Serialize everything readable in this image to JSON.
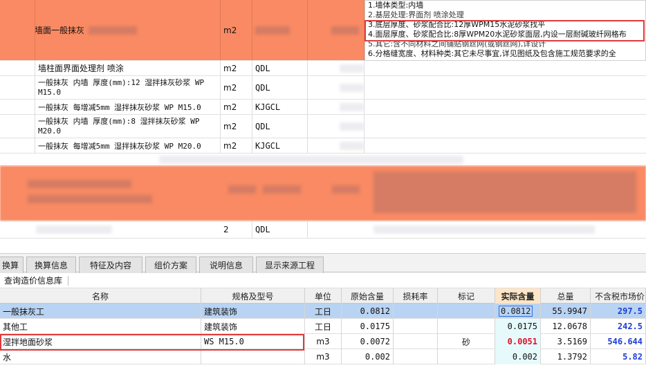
{
  "top_rows": [
    {
      "name": "墙面一般抹灰",
      "unit": "m2",
      "code": ""
    },
    {
      "name": "墙柱面界面处理剂 喷涂",
      "unit": "m2",
      "code": "QDL"
    },
    {
      "name": "一般抹灰 内墙 厚度(mm):12 湿拌抹灰砂浆 WP M15.0",
      "unit": "m2",
      "code": "QDL"
    },
    {
      "name": "一般抹灰 每增减5mm 湿拌抹灰砂浆 WP M15.0",
      "unit": "m2",
      "code": "KJGCL"
    },
    {
      "name": "一般抹灰 内墙 厚度(mm):8 湿拌抹灰砂浆 WP M20.0",
      "unit": "m2",
      "code": "QDL"
    },
    {
      "name": "一般抹灰 每增减5mm 湿拌抹灰砂浆 WP M20.0",
      "unit": "m2",
      "code": "KJGCL"
    },
    {
      "name": "",
      "unit": "2",
      "code": "QDL"
    }
  ],
  "description": {
    "line1": "1.墙体类型:内墙",
    "line2": "2.基层处理:界面剂 喷涂处理",
    "line3": "3.底层厚度、砂浆配合比:12厚WPM15水泥砂浆找平",
    "line4": "4.面层厚度、砂浆配合比:8厚WPM20水泥砂浆面层,内设一层耐碱玻纤网格布",
    "line5": "5.其它:含不同材料之间铺贴钢丝网(或钢丝网),详设计",
    "line6": "6.分格缝宽度、材料种类:其它未尽事宜,详见图纸及包含施工规范要求的全"
  },
  "tabs": [
    "换算",
    "换算信息",
    "特征及内容",
    "组价方案",
    "说明信息",
    "显示来源工程"
  ],
  "info_bar_label": "查询造价信息库",
  "table": {
    "headers": {
      "name": "名称",
      "spec": "规格及型号",
      "unit": "单位",
      "orig": "原始含量",
      "loss": "损耗率",
      "mark": "标记",
      "actual": "实际含量",
      "total": "总量",
      "price": "不含税市场价"
    },
    "rows": [
      {
        "name": "一般抹灰工",
        "spec": "建筑装饰",
        "unit": "工日",
        "orig": "0.0812",
        "loss": "",
        "mark": "",
        "actual": "0.0812",
        "total": "55.9947",
        "price": "297.5"
      },
      {
        "name": "其他工",
        "spec": "建筑装饰",
        "unit": "工日",
        "orig": "0.0175",
        "loss": "",
        "mark": "",
        "actual": "0.0175",
        "total": "12.0678",
        "price": "242.5"
      },
      {
        "name": "湿拌地面砂浆",
        "spec": "WS M15.0",
        "unit": "m3",
        "orig": "0.0072",
        "loss": "",
        "mark": "砂",
        "actual": "0.0051",
        "total": "3.5169",
        "price": "546.644"
      },
      {
        "name": "水",
        "spec": "",
        "unit": "m3",
        "orig": "0.002",
        "loss": "",
        "mark": "",
        "actual": "0.002",
        "total": "1.3792",
        "price": "5.82"
      }
    ]
  },
  "colors": {
    "highlight_row": "#f98a63",
    "selected_row": "#b9d3f3",
    "annotation_box": "#e03a3a",
    "price_text": "#1f3dd6",
    "changed_value": "#e0102a"
  },
  "icons": [
    "lock-icon"
  ]
}
